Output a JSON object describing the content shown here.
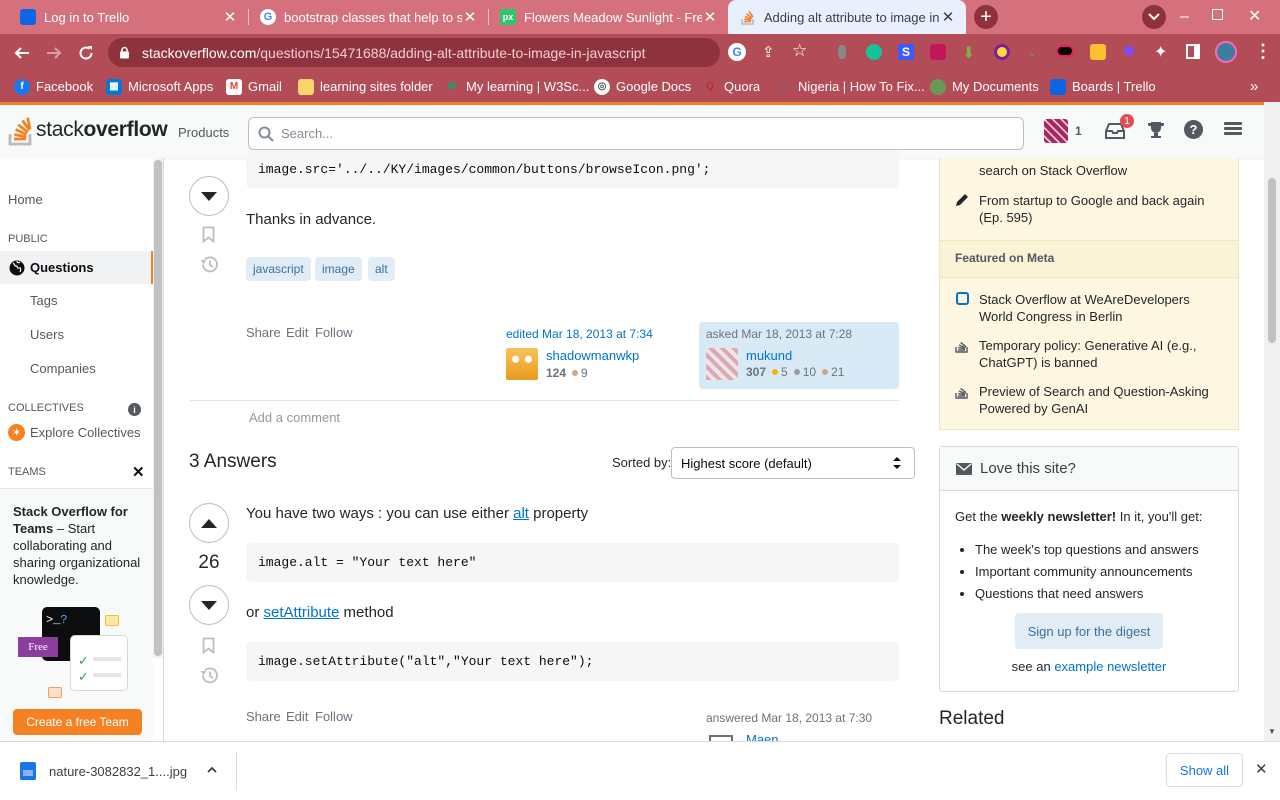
{
  "browser": {
    "tabs": [
      {
        "title": "Log in to Trello",
        "icon": "trello-icon",
        "color": "#0c66e4"
      },
      {
        "title": "bootstrap classes that help to sp...",
        "icon": "google-icon",
        "color": "#ffffff"
      },
      {
        "title": "Flowers Meadow Sunlight - Free",
        "icon": "pixabay-icon",
        "color": "#2ec66d"
      },
      {
        "title": "Adding alt attribute to image in j...",
        "icon": "stackoverflow-icon",
        "color": "#f48225"
      }
    ],
    "url_host": "stackoverflow.com",
    "url_path": "/questions/15471688/adding-alt-attribute-to-image-in-javascript",
    "bookmarks": [
      "Facebook",
      "Microsoft Apps",
      "Gmail",
      "learning sites folder",
      "My learning | W3Sc...",
      "Google Docs",
      "Quora",
      "Nigeria | How To Fix...",
      "My Documents",
      "Boards | Trello"
    ]
  },
  "so_header": {
    "logo_text_light": "stack",
    "logo_text_bold": "overflow",
    "products": "Products",
    "search_placeholder": "Search...",
    "rep": "1",
    "inbox_badge": "1"
  },
  "leftnav": {
    "home": "Home",
    "public": "PUBLIC",
    "questions": "Questions",
    "tags": "Tags",
    "users": "Users",
    "companies": "Companies",
    "collectives": "COLLECTIVES",
    "explore": "Explore Collectives",
    "teams": "TEAMS",
    "teams_title": "Stack Overflow for Teams",
    "teams_desc": " – Start collaborating and sharing organizational knowledge.",
    "free_badge": "Free",
    "create_team": "Create a free Team"
  },
  "question": {
    "code_line": "image.src='../../KY/images/common/buttons/browseIcon.png';",
    "thanks": "Thanks in advance.",
    "tags": [
      "javascript",
      "image",
      "alt"
    ],
    "actions": [
      "Share",
      "Edit",
      "Follow"
    ],
    "edited_label": "edited Mar 18, 2013 at 7:34",
    "editor_name": "shadowmanwkp",
    "editor_rep": "124",
    "editor_bronze": "9",
    "asked_label": "asked Mar 18, 2013 at 7:28",
    "asker_name": "mukund",
    "asker_rep": "307",
    "asker_gold": "5",
    "asker_silver": "10",
    "asker_bronze": "21",
    "add_comment": "Add a comment"
  },
  "answers": {
    "count_label": "3 Answers",
    "sorted_by": "Sorted by:",
    "sort_value": "Highest score (default)",
    "first": {
      "score": "26",
      "text_pre": "You have two ways : you can use either ",
      "link1": "alt",
      "text_post": " property",
      "code1": "image.alt = \"Your text here\"",
      "or_pre": "or ",
      "link2": "setAttribute",
      "or_post": " method",
      "code2": "image.setAttribute(\"alt\",\"Your text here\");",
      "actions": [
        "Share",
        "Edit",
        "Follow"
      ],
      "answered_label": "answered Mar 18, 2013 at 7:30",
      "answerer_name": "Maen"
    }
  },
  "sidebar": {
    "blog_item_partial": "search on Stack Overflow",
    "blog_item2": "From startup to Google and back again (Ep. 595)",
    "featured_meta": "Featured on Meta",
    "meta_items": [
      "Stack Overflow at WeAreDevelopers World Congress in Berlin",
      "Temporary policy: Generative AI (e.g., ChatGPT) is banned",
      "Preview of Search and Question-Asking Powered by GenAI"
    ],
    "love_title": "Love this site?",
    "newsletter_pre": "Get the ",
    "newsletter_bold": "weekly newsletter!",
    "newsletter_post": " In it, you'll get:",
    "bullets": [
      "The week's top questions and answers",
      "Important community announcements",
      "Questions that need answers"
    ],
    "signup_button": "Sign up for the digest",
    "see_an": "see an ",
    "example_link": "example newsletter",
    "related": "Related"
  },
  "downloads": {
    "file": "nature-3082832_1....jpg",
    "show_all": "Show all"
  }
}
